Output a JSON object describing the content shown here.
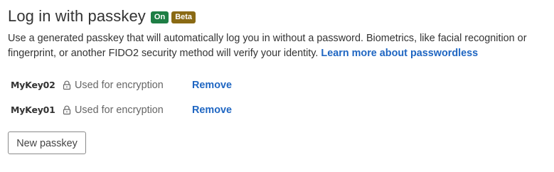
{
  "section": {
    "title": "Log in with passkey",
    "badge_on": "On",
    "badge_beta": "Beta",
    "description": "Use a generated passkey that will automatically log you in without a password. Biometrics, like facial recognition or fingerprint, or another FIDO2 security method will verify your identity.",
    "learn_more_link": "Learn more about passwordless"
  },
  "keys": [
    {
      "name": "MyKey02",
      "usage": "Used for encryption",
      "remove_label": "Remove",
      "usage_icon": "lock-icon"
    },
    {
      "name": "MyKey01",
      "usage": "Used for encryption",
      "remove_label": "Remove",
      "usage_icon": "lock-icon"
    }
  ],
  "actions": {
    "new_passkey_label": "New passkey"
  },
  "colors": {
    "badge_on_bg": "#1e7e45",
    "badge_beta_bg": "#8a6a14",
    "link": "#1f66c2",
    "text": "#333333"
  }
}
